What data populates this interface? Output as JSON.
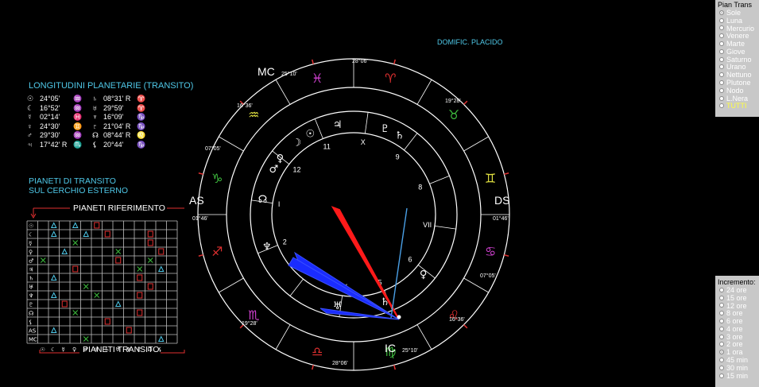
{
  "header": {
    "domific": "DOMIFIC. PLACIDO",
    "longitudini_title": "LONGITUDINI PLANETARIE (TRANSITO)",
    "transit_note_1": "PIANETI DI TRANSITO",
    "transit_note_2": "SUL CERCHIO ESTERNO",
    "pianeti_riferimento": "PIANETI RIFERIMENTO",
    "pianeti_transito": "PIANETI TRANSITO"
  },
  "planet_positions_left": [
    {
      "symbol": "☉",
      "value": "24°05'",
      "sign": "♒"
    },
    {
      "symbol": "☾",
      "value": "16°52'",
      "sign": "♒"
    },
    {
      "symbol": "☿",
      "value": "02°14'",
      "sign": "♓"
    },
    {
      "symbol": "♀",
      "value": "24°30'",
      "sign": "♊"
    },
    {
      "symbol": "♂",
      "value": "29°30'",
      "sign": "♒"
    },
    {
      "symbol": "♃",
      "value": "17°42' R",
      "sign": "♏"
    }
  ],
  "planet_positions_right": [
    {
      "symbol": "♄",
      "value": "08°31' R",
      "sign": "♈"
    },
    {
      "symbol": "♅",
      "value": "29°59'",
      "sign": "♈"
    },
    {
      "symbol": "♆",
      "value": "16°09'",
      "sign": "♑"
    },
    {
      "symbol": "♇",
      "value": "21°04' R",
      "sign": "♑"
    },
    {
      "symbol": "☊",
      "value": "08°44' R",
      "sign": "♌"
    },
    {
      "symbol": "⚸",
      "value": "20°44'",
      "sign": "♑"
    }
  ],
  "grid_row_symbols": [
    "☉",
    "☾",
    "☿",
    "♀",
    "♂",
    "♃",
    "♄",
    "♅",
    "♆",
    "♇",
    "☊",
    "⚸",
    "AS",
    "MC"
  ],
  "grid_col_symbols": [
    "☉",
    "☾",
    "☿",
    "♀",
    "♂",
    "♃",
    "♄",
    "♅",
    "♆",
    "♇",
    "☊",
    "⚸"
  ],
  "chart": {
    "angles": {
      "as": "AS",
      "ds": "DS",
      "mc": "MC",
      "ic": "IC"
    },
    "degrees": {
      "mc": "25°10'",
      "top": "28°06'",
      "upper_right": "19°28'",
      "upper_left": "16°36'",
      "left_upper": "07°05'",
      "as": "01°46'",
      "ds": "01°46'",
      "right_lower": "07°05'",
      "lower_right": "16°36'",
      "lower_left": "19°28'",
      "bottom": "28°06'",
      "ic": "25°10'"
    },
    "houses": [
      "I",
      "2",
      "3",
      "IV",
      "5",
      "6",
      "VII",
      "8",
      "9",
      "X",
      "11",
      "12"
    ]
  },
  "panel_trans": {
    "title": "Pian Trans",
    "options": [
      "Sole",
      "Luna",
      "Mercurio",
      "Venere",
      "Marte",
      "Giove",
      "Saturno",
      "Urano",
      "Nettuno",
      "Plutone",
      "Nodo",
      "L.Nera",
      "TUTTI"
    ],
    "selected": "Sole"
  },
  "panel_incremento": {
    "title": "Incremento:",
    "options": [
      "24 ore",
      "15 ore",
      "12 ore",
      "8 ore",
      "6 ore",
      "4 ore",
      "3 ore",
      "2 ore",
      "1 ora",
      "45 min",
      "30 min",
      "15 min"
    ],
    "selected": "1 ora"
  }
}
